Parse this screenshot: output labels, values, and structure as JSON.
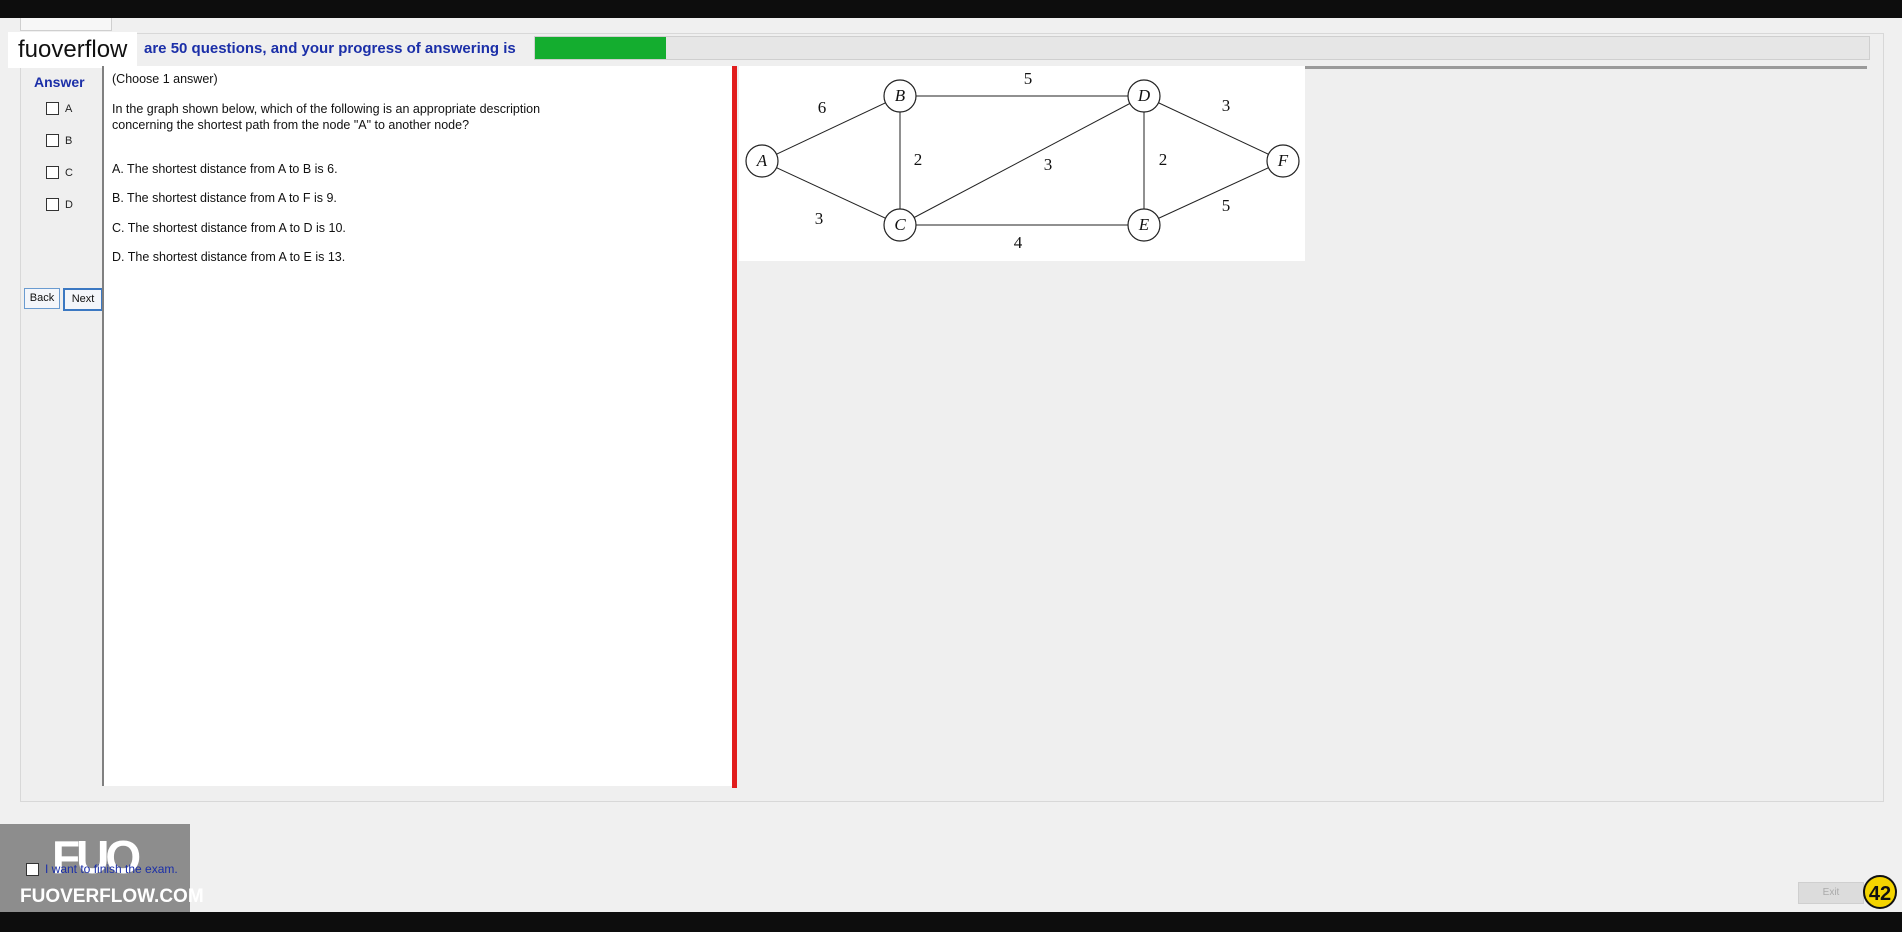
{
  "brand": "fuoverflow",
  "progress": {
    "text": "are 50 questions, and your progress of answering is",
    "fraction": 0.098,
    "color": "#14ad2f"
  },
  "answer": {
    "title": "Answer",
    "options": [
      "A",
      "B",
      "C",
      "D"
    ]
  },
  "nav": {
    "back": "Back",
    "next": "Next"
  },
  "question": {
    "instruction": "(Choose 1 answer)",
    "prompt_line1": "In the graph shown below, which of the following is an appropriate description",
    "prompt_line2": "concerning the shortest path from the node \"A\" to another node?",
    "choices": [
      "A.  The shortest distance from A to B is 6.",
      "B.  The shortest distance from A to F is 9.",
      "C.  The shortest distance from A to D is 10.",
      "D.  The shortest distance from A to E is 13."
    ]
  },
  "graph": {
    "nodes": [
      "A",
      "B",
      "C",
      "D",
      "E",
      "F"
    ],
    "edges": [
      {
        "from": "A",
        "to": "B",
        "weight": "6"
      },
      {
        "from": "A",
        "to": "C",
        "weight": "3"
      },
      {
        "from": "B",
        "to": "D",
        "weight": "5"
      },
      {
        "from": "B",
        "to": "C",
        "weight": "2"
      },
      {
        "from": "C",
        "to": "D",
        "weight": "3"
      },
      {
        "from": "C",
        "to": "E",
        "weight": "4"
      },
      {
        "from": "D",
        "to": "E",
        "weight": "2"
      },
      {
        "from": "D",
        "to": "F",
        "weight": "3"
      },
      {
        "from": "E",
        "to": "F",
        "weight": "5"
      }
    ]
  },
  "finish_label": "I want to finish the exam.",
  "logo": {
    "mark": "FUO",
    "site": "FUOVERFLOW.COM"
  },
  "exit": "Exit",
  "badge": "42",
  "colors": {
    "accent": "#1b2fa8",
    "divider": "#e11d1d",
    "badge": "#f4d400"
  }
}
